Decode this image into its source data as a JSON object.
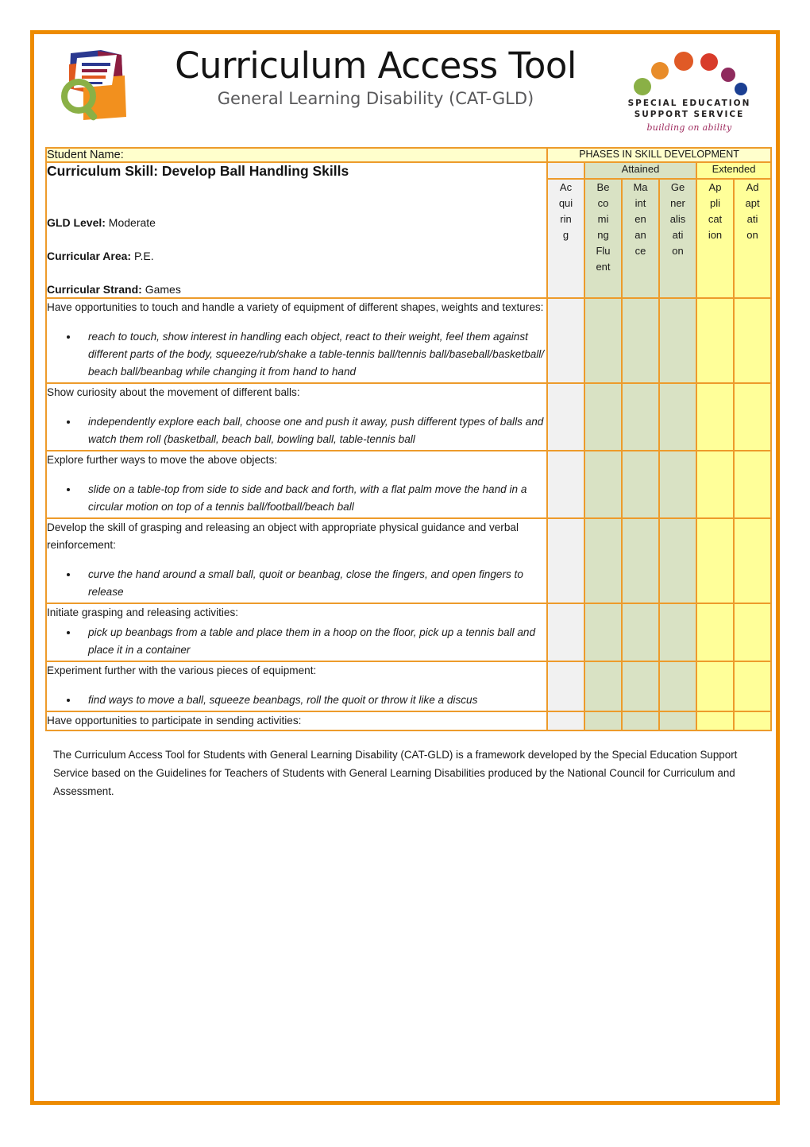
{
  "header": {
    "title": "Curriculum Access Tool",
    "subtitle": "General Learning Disability (CAT-GLD)",
    "cat_logo_name": "curriculum-access-tool-logo",
    "sess_logo": {
      "line1": "SPECIAL EDUCATION",
      "line2": "SUPPORT SERVICE",
      "tagline": "building on ability",
      "dot_colors": [
        "#8ab046",
        "#e88c2a",
        "#e05a26",
        "#d83b2a",
        "#8f2b5e",
        "#1b3f92"
      ]
    }
  },
  "table": {
    "student_name_label": "Student Name:",
    "phases_header": "PHASES IN SKILL DEVELOPMENT",
    "bands": {
      "attained": "Attained",
      "extended": "Extended"
    },
    "columns": [
      {
        "label": "Acquiring",
        "wrapped": "Ac\nqui\nrin\ng",
        "group": "none",
        "color": "#f1f1f1"
      },
      {
        "label": "Becoming Fluent",
        "wrapped": "Be\nco\nmi\nng\nFlu\nent",
        "group": "attained",
        "color": "#d9e2c4"
      },
      {
        "label": "Maintenance",
        "wrapped": "Ma\nint\nen\nan\nce",
        "group": "attained",
        "color": "#d9e2c4"
      },
      {
        "label": "Generalisation",
        "wrapped": "Ge\nner\nalis\nati\non",
        "group": "attained",
        "color": "#d9e2c4"
      },
      {
        "label": "Application",
        "wrapped": "Ap\npli\ncat\nion",
        "group": "extended",
        "color": "#ffff99"
      },
      {
        "label": "Adaptation",
        "wrapped": "Ad\napt\nati\non",
        "group": "extended",
        "color": "#ffff99"
      }
    ],
    "info": {
      "skill_title": "Curriculum Skill:  Develop Ball Handling Skills",
      "gld_level_label": "GLD Level:",
      "gld_level_value": "Moderate",
      "curricular_area_label": "Curricular Area:",
      "curricular_area_value": "P.E.",
      "curricular_strand_label": "Curricular Strand:",
      "curricular_strand_value": "Games"
    },
    "rows": [
      {
        "lead": "Have opportunities to touch and handle a variety of equipment of different shapes, weights and textures:",
        "bullets": [
          "reach to touch, show interest in handling each object, react to their weight, feel them against different parts of the body, squeeze/rub/shake a table-tennis ball/tennis ball/baseball/basketball/ beach ball/beanbag while changing it from hand to hand"
        ],
        "tight": false
      },
      {
        "lead": "Show curiosity about the movement of different balls:",
        "bullets": [
          "independently explore each ball, choose  one and push it away, push different types of balls and watch them roll (basketball, beach ball, bowling ball, table-tennis ball"
        ],
        "tight": false
      },
      {
        "lead": "Explore further ways to move the above objects:",
        "bullets": [
          "slide on a table-top from side to side and back and forth, with a flat palm move the hand in a circular motion on top of a tennis ball/football/beach ball"
        ],
        "tight": false
      },
      {
        "lead": "Develop the skill of grasping and releasing an object with appropriate physical guidance  and verbal reinforcement:",
        "bullets": [
          "curve the hand around a small ball, quoit or beanbag,  close the fingers, and open fingers to release"
        ],
        "tight": false
      },
      {
        "lead": "Initiate grasping and releasing activities:",
        "bullets": [
          "pick up beanbags  from a table and place them in a hoop on the floor, pick up a tennis ball and place it in a container"
        ],
        "tight": true
      },
      {
        "lead": "Experiment further with the various pieces of equipment:",
        "bullets": [
          "find ways to move a ball, squeeze beanbags,  roll the quoit or throw it like a discus"
        ],
        "tight": false
      },
      {
        "lead": "Have opportunities to participate in sending activities:",
        "bullets": [],
        "tight": false
      }
    ]
  },
  "footnote": "The Curriculum Access Tool for Students with General Learning Disability (CAT-GLD) is a framework developed by the Special Education Support Service based on the Guidelines for Teachers of Students with General Learning Disabilities produced by the National Council for Curriculum and Assessment.",
  "colors": {
    "frame": "#ED8B00",
    "grid_line": "#ED9B2B",
    "header_yellow": "#ffffcc",
    "attained_green": "#d9e2c4",
    "extended_yellow": "#ffff99",
    "acquiring_gray": "#f1f1f1"
  }
}
